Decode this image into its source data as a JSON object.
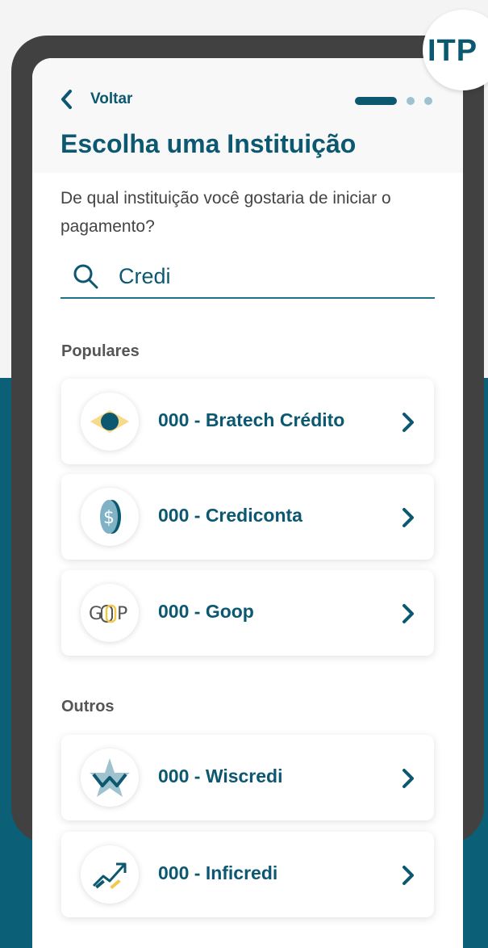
{
  "badge": "ITP",
  "header": {
    "back_label": "Voltar",
    "title": "Escolha uma Instituição"
  },
  "subtitle": "De qual instituição você gostaria de iniciar o pagamento?",
  "search": {
    "value": "Credi",
    "icon": "search-icon"
  },
  "sections": {
    "popular_label": "Populares",
    "others_label": "Outros"
  },
  "popular": [
    {
      "label": "000 - Bratech Crédito",
      "icon": "bratech-logo-icon"
    },
    {
      "label": "000 - Crediconta",
      "icon": "crediconta-logo-icon"
    },
    {
      "label": "000 - Goop",
      "icon": "goop-logo-icon"
    }
  ],
  "others": [
    {
      "label": "000 - Wiscredi",
      "icon": "wiscredi-logo-icon"
    },
    {
      "label": "000 - Inficredi",
      "icon": "inficredi-logo-icon"
    }
  ],
  "colors": {
    "primary": "#0b5870",
    "background_teal": "#0b6078",
    "phone_frame": "#414141"
  }
}
